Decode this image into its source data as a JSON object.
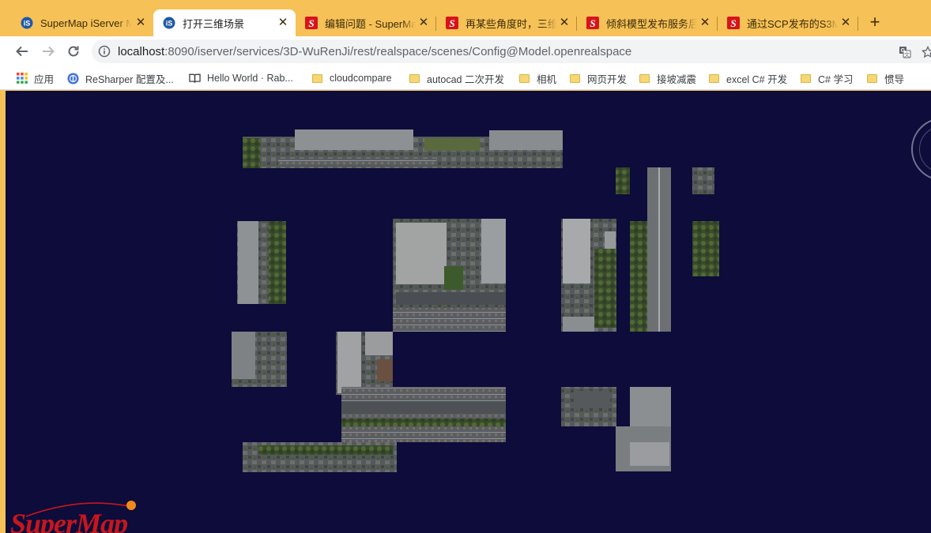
{
  "browser": {
    "tabs": [
      {
        "title": "SuperMap iServer M",
        "favicon": "supermap-iserver-icon",
        "active": false
      },
      {
        "title": "打开三维场景",
        "favicon": "supermap-iserver-icon",
        "active": true
      },
      {
        "title": "编辑问题 - SuperMa",
        "favicon": "supermap-s-icon",
        "active": false
      },
      {
        "title": "再某些角度时，三维",
        "favicon": "supermap-s-icon",
        "active": false
      },
      {
        "title": "倾斜模型发布服务后",
        "favicon": "supermap-s-icon",
        "active": false
      },
      {
        "title": "通过SCP发布的S3M",
        "favicon": "supermap-s-icon",
        "active": false
      }
    ],
    "new_tab_label": "+",
    "close_glyph": "✕",
    "address": {
      "host": "localhost",
      "path": ":8090/iserver/services/3D-WuRenJi/rest/realspace/scenes/Config@Model.openrealspace"
    },
    "bookmarks": [
      {
        "label": "应用",
        "icon": "apps-grid-icon"
      },
      {
        "label": "ReSharper 配置及...",
        "icon": "globe-icon"
      },
      {
        "label": "Hello World · Rab...",
        "icon": "book-icon"
      },
      {
        "label": "cloudcompare",
        "icon": "folder-icon"
      },
      {
        "label": "autocad 二次开发",
        "icon": "folder-icon"
      },
      {
        "label": "相机",
        "icon": "folder-icon"
      },
      {
        "label": "网页开发",
        "icon": "folder-icon"
      },
      {
        "label": "接坡减震",
        "icon": "folder-icon"
      },
      {
        "label": "excel C# 开发",
        "icon": "folder-icon"
      },
      {
        "label": "C# 学习",
        "icon": "folder-icon"
      },
      {
        "label": "惯导",
        "icon": "folder-icon"
      }
    ]
  },
  "scene": {
    "background_color": "#0d0c3a",
    "logo_text": "SuperMap",
    "logo_color": "#c8161d"
  },
  "theme": {
    "tabstrip_color": "#f6c157",
    "accent_blue": "#1a73e8"
  }
}
